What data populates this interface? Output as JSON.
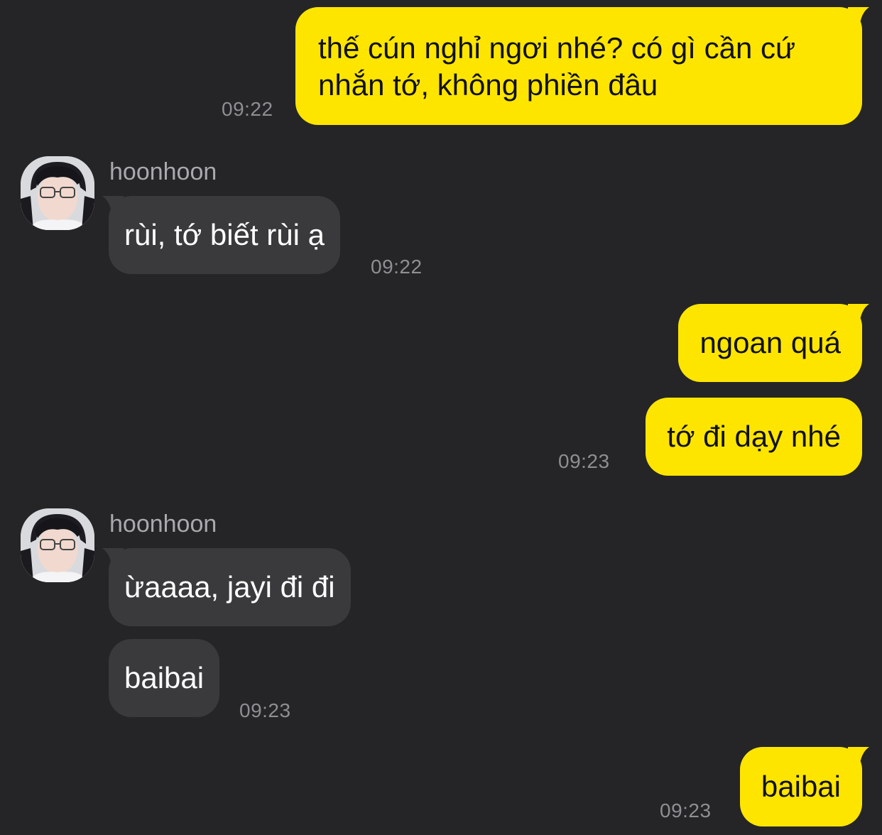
{
  "contact": {
    "name": "hoonhoon"
  },
  "colors": {
    "background": "#252527",
    "sent_bubble": "#FEE500",
    "received_bubble": "#3A3A3C",
    "timestamp": "#8E8E93"
  },
  "messages": [
    {
      "from": "me",
      "text": "thế cún nghỉ ngơi nhé? có gì cần cứ nhắn tớ, không phiền đâu",
      "time": "09:22"
    },
    {
      "from": "them",
      "sender": "hoonhoon",
      "text": "rùi, tớ biết rùi ạ",
      "time": "09:22"
    },
    {
      "from": "me",
      "text": "ngoan quá",
      "time": ""
    },
    {
      "from": "me",
      "text": "tớ đi dạy nhé",
      "time": "09:23"
    },
    {
      "from": "them",
      "sender": "hoonhoon",
      "text": "ừaaaa, jayi đi đi",
      "time": ""
    },
    {
      "from": "them",
      "text": "baibai",
      "time": "09:23"
    },
    {
      "from": "me",
      "text": "baibai",
      "time": "09:23"
    }
  ]
}
